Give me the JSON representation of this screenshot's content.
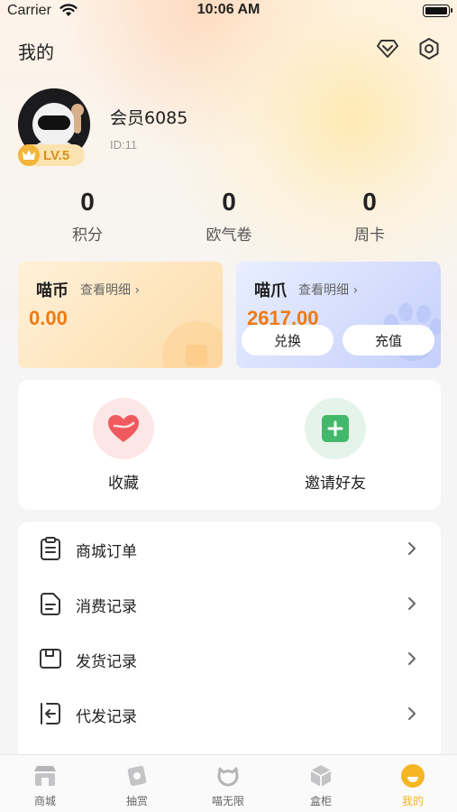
{
  "status_bar": {
    "carrier": "Carrier",
    "time": "10:06 AM"
  },
  "header": {
    "title": "我的",
    "icons": [
      "diamond-icon",
      "settings-icon"
    ]
  },
  "profile": {
    "username": "会员6085",
    "user_id": "ID:11",
    "level": "LV.5"
  },
  "stats": [
    {
      "value": "0",
      "label": "积分"
    },
    {
      "value": "0",
      "label": "欧气卷"
    },
    {
      "value": "0",
      "label": "周卡"
    }
  ],
  "wallet": {
    "coin": {
      "title": "喵币",
      "detail": "查看明细",
      "value": "0.00"
    },
    "claw": {
      "title": "喵爪",
      "detail": "查看明细",
      "value": "2617.00",
      "exchange_label": "兑换",
      "recharge_label": "充值"
    }
  },
  "quick_actions": [
    {
      "label": "收藏",
      "icon": "heart-icon"
    },
    {
      "label": "邀请好友",
      "icon": "invite-icon"
    }
  ],
  "menu": [
    {
      "label": "商城订单",
      "icon": "clipboard-icon"
    },
    {
      "label": "消费记录",
      "icon": "document-icon"
    },
    {
      "label": "发货记录",
      "icon": "save-box-icon"
    },
    {
      "label": "代发记录",
      "icon": "arrow-in-icon"
    }
  ],
  "tabs": [
    {
      "label": "商城",
      "icon": "store-icon"
    },
    {
      "label": "抽赏",
      "icon": "prize-icon"
    },
    {
      "label": "喵无限",
      "icon": "cat-icon"
    },
    {
      "label": "盒柜",
      "icon": "box-icon"
    },
    {
      "label": "我的",
      "icon": "profile-icon",
      "active": true
    }
  ],
  "colors": {
    "accent": "#f3b22c",
    "coin_value": "#f07a10",
    "wallet_coin_bg": "#fddcaa",
    "wallet_claw_bg": "#c5d0fb"
  }
}
